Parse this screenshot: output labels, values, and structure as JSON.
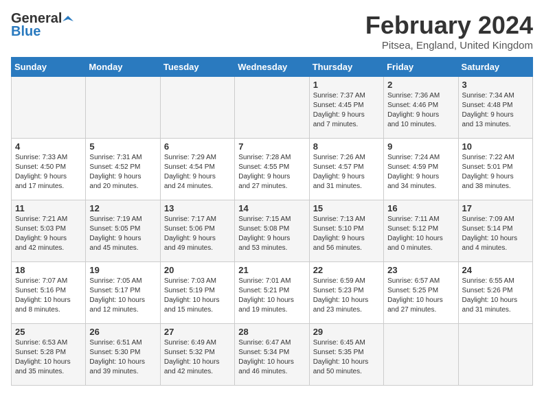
{
  "logo": {
    "general": "General",
    "blue": "Blue"
  },
  "header": {
    "month": "February 2024",
    "location": "Pitsea, England, United Kingdom"
  },
  "weekdays": [
    "Sunday",
    "Monday",
    "Tuesday",
    "Wednesday",
    "Thursday",
    "Friday",
    "Saturday"
  ],
  "weeks": [
    [
      {
        "day": "",
        "info": ""
      },
      {
        "day": "",
        "info": ""
      },
      {
        "day": "",
        "info": ""
      },
      {
        "day": "",
        "info": ""
      },
      {
        "day": "1",
        "info": "Sunrise: 7:37 AM\nSunset: 4:45 PM\nDaylight: 9 hours\nand 7 minutes."
      },
      {
        "day": "2",
        "info": "Sunrise: 7:36 AM\nSunset: 4:46 PM\nDaylight: 9 hours\nand 10 minutes."
      },
      {
        "day": "3",
        "info": "Sunrise: 7:34 AM\nSunset: 4:48 PM\nDaylight: 9 hours\nand 13 minutes."
      }
    ],
    [
      {
        "day": "4",
        "info": "Sunrise: 7:33 AM\nSunset: 4:50 PM\nDaylight: 9 hours\nand 17 minutes."
      },
      {
        "day": "5",
        "info": "Sunrise: 7:31 AM\nSunset: 4:52 PM\nDaylight: 9 hours\nand 20 minutes."
      },
      {
        "day": "6",
        "info": "Sunrise: 7:29 AM\nSunset: 4:54 PM\nDaylight: 9 hours\nand 24 minutes."
      },
      {
        "day": "7",
        "info": "Sunrise: 7:28 AM\nSunset: 4:55 PM\nDaylight: 9 hours\nand 27 minutes."
      },
      {
        "day": "8",
        "info": "Sunrise: 7:26 AM\nSunset: 4:57 PM\nDaylight: 9 hours\nand 31 minutes."
      },
      {
        "day": "9",
        "info": "Sunrise: 7:24 AM\nSunset: 4:59 PM\nDaylight: 9 hours\nand 34 minutes."
      },
      {
        "day": "10",
        "info": "Sunrise: 7:22 AM\nSunset: 5:01 PM\nDaylight: 9 hours\nand 38 minutes."
      }
    ],
    [
      {
        "day": "11",
        "info": "Sunrise: 7:21 AM\nSunset: 5:03 PM\nDaylight: 9 hours\nand 42 minutes."
      },
      {
        "day": "12",
        "info": "Sunrise: 7:19 AM\nSunset: 5:05 PM\nDaylight: 9 hours\nand 45 minutes."
      },
      {
        "day": "13",
        "info": "Sunrise: 7:17 AM\nSunset: 5:06 PM\nDaylight: 9 hours\nand 49 minutes."
      },
      {
        "day": "14",
        "info": "Sunrise: 7:15 AM\nSunset: 5:08 PM\nDaylight: 9 hours\nand 53 minutes."
      },
      {
        "day": "15",
        "info": "Sunrise: 7:13 AM\nSunset: 5:10 PM\nDaylight: 9 hours\nand 56 minutes."
      },
      {
        "day": "16",
        "info": "Sunrise: 7:11 AM\nSunset: 5:12 PM\nDaylight: 10 hours\nand 0 minutes."
      },
      {
        "day": "17",
        "info": "Sunrise: 7:09 AM\nSunset: 5:14 PM\nDaylight: 10 hours\nand 4 minutes."
      }
    ],
    [
      {
        "day": "18",
        "info": "Sunrise: 7:07 AM\nSunset: 5:16 PM\nDaylight: 10 hours\nand 8 minutes."
      },
      {
        "day": "19",
        "info": "Sunrise: 7:05 AM\nSunset: 5:17 PM\nDaylight: 10 hours\nand 12 minutes."
      },
      {
        "day": "20",
        "info": "Sunrise: 7:03 AM\nSunset: 5:19 PM\nDaylight: 10 hours\nand 15 minutes."
      },
      {
        "day": "21",
        "info": "Sunrise: 7:01 AM\nSunset: 5:21 PM\nDaylight: 10 hours\nand 19 minutes."
      },
      {
        "day": "22",
        "info": "Sunrise: 6:59 AM\nSunset: 5:23 PM\nDaylight: 10 hours\nand 23 minutes."
      },
      {
        "day": "23",
        "info": "Sunrise: 6:57 AM\nSunset: 5:25 PM\nDaylight: 10 hours\nand 27 minutes."
      },
      {
        "day": "24",
        "info": "Sunrise: 6:55 AM\nSunset: 5:26 PM\nDaylight: 10 hours\nand 31 minutes."
      }
    ],
    [
      {
        "day": "25",
        "info": "Sunrise: 6:53 AM\nSunset: 5:28 PM\nDaylight: 10 hours\nand 35 minutes."
      },
      {
        "day": "26",
        "info": "Sunrise: 6:51 AM\nSunset: 5:30 PM\nDaylight: 10 hours\nand 39 minutes."
      },
      {
        "day": "27",
        "info": "Sunrise: 6:49 AM\nSunset: 5:32 PM\nDaylight: 10 hours\nand 42 minutes."
      },
      {
        "day": "28",
        "info": "Sunrise: 6:47 AM\nSunset: 5:34 PM\nDaylight: 10 hours\nand 46 minutes."
      },
      {
        "day": "29",
        "info": "Sunrise: 6:45 AM\nSunset: 5:35 PM\nDaylight: 10 hours\nand 50 minutes."
      },
      {
        "day": "",
        "info": ""
      },
      {
        "day": "",
        "info": ""
      }
    ]
  ]
}
